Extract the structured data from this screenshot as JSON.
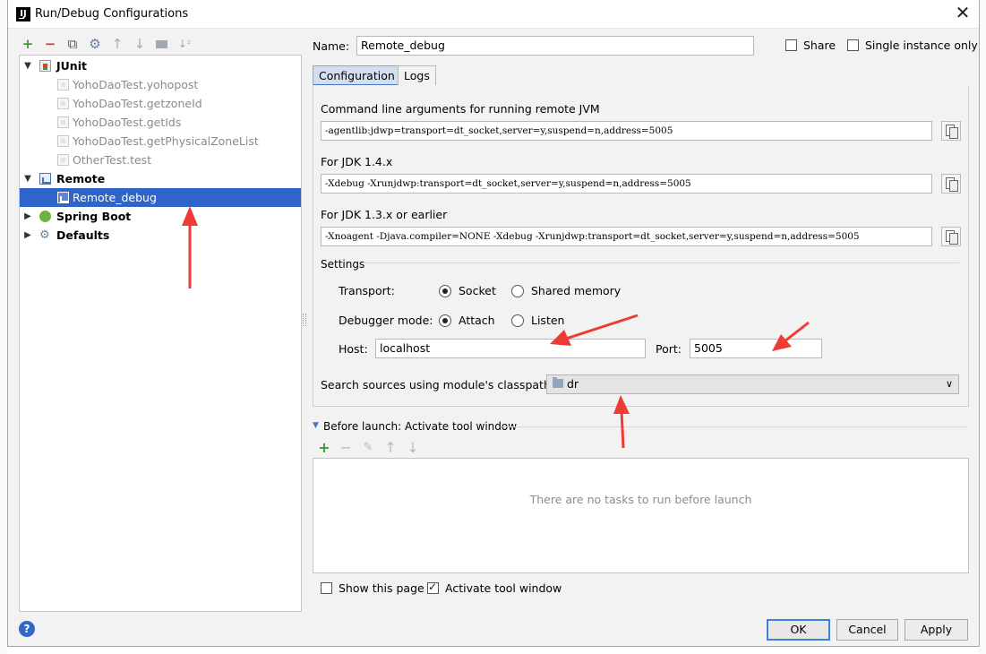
{
  "dialog": {
    "title": "Run/Debug Configurations",
    "close_icon": "close-icon"
  },
  "left_toolbar": [
    "add-icon",
    "remove-icon",
    "copy-icon",
    "wrench-icon",
    "move-up-icon",
    "move-down-icon",
    "folder-icon",
    "sort-icon"
  ],
  "tree": {
    "junit": {
      "label": "JUnit",
      "items": [
        "YohoDaoTest.yohopost",
        "YohoDaoTest.getzoneId",
        "YohoDaoTest.getIds",
        "YohoDaoTest.getPhysicalZoneList",
        "OtherTest.test"
      ]
    },
    "remote": {
      "label": "Remote",
      "items": [
        "Remote_debug"
      ]
    },
    "spring_boot": "Spring Boot",
    "defaults": "Defaults"
  },
  "form": {
    "name_label": "Name:",
    "name_value": "Remote_debug",
    "share_label": "Share",
    "single_instance_label": "Single instance only",
    "tabs": [
      "Configuration",
      "Logs"
    ],
    "cmdline_label": "Command line arguments for running remote JVM",
    "cmdline_value": "-agentlib:jdwp=transport=dt_socket,server=y,suspend=n,address=5005",
    "jdk14_label": "For JDK 1.4.x",
    "jdk14_value": "-Xdebug -Xrunjdwp:transport=dt_socket,server=y,suspend=n,address=5005",
    "jdk13_label": "For JDK 1.3.x or earlier",
    "jdk13_value": "-Xnoagent -Djava.compiler=NONE -Xdebug -Xrunjdwp:transport=dt_socket,server=y,suspend=n,address=5005",
    "settings_label": "Settings",
    "transport_label": "Transport:",
    "transport_socket": "Socket",
    "transport_shared": "Shared memory",
    "debugger_mode_label": "Debugger mode:",
    "mode_attach": "Attach",
    "mode_listen": "Listen",
    "host_label": "Host:",
    "host_value": "localhost",
    "port_label": "Port:",
    "port_value": "5005",
    "classpath_label": "Search sources using module's classpath:",
    "classpath_value": "dr"
  },
  "before_launch": {
    "title": "Before launch: Activate tool window",
    "toolbar": [
      "add-icon",
      "remove-icon",
      "edit-icon",
      "move-up-icon",
      "move-down-icon"
    ],
    "empty_text": "There are no tasks to run before launch",
    "show_page_label": "Show this page",
    "activate_tool_label": "Activate tool window"
  },
  "buttons": {
    "ok": "OK",
    "cancel": "Cancel",
    "apply": "Apply",
    "help": "?"
  },
  "colors": {
    "selection": "#2f65ca",
    "annotation_arrow": "#ee3b33",
    "add_green": "#3c9d2f",
    "remove_red": "#d23b3b"
  }
}
